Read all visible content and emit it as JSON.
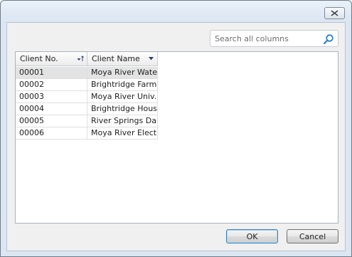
{
  "dialog": {
    "close_label": "Close"
  },
  "search": {
    "placeholder": "Search all columns",
    "value": ""
  },
  "grid": {
    "columns": [
      {
        "label": "Client No.",
        "sort": "ascending"
      },
      {
        "label": "Client Name",
        "sort": "dropdown"
      }
    ],
    "rows": [
      {
        "no": "00001",
        "name": "Moya River Wate..."
      },
      {
        "no": "00002",
        "name": "Brightridge Farm ..."
      },
      {
        "no": "00003",
        "name": "Moya River Univ..."
      },
      {
        "no": "00004",
        "name": "Brightridge Housi..."
      },
      {
        "no": "00005",
        "name": "River Springs Dai..."
      },
      {
        "no": "00006",
        "name": "Moya River Electr..."
      }
    ],
    "selected_row": 0
  },
  "buttons": {
    "ok": "OK",
    "cancel": "Cancel"
  },
  "colors": {
    "frame": "#dbe6f2",
    "selected_row": "#e3e3e3",
    "sort_arrow": "#2a3f7a"
  }
}
